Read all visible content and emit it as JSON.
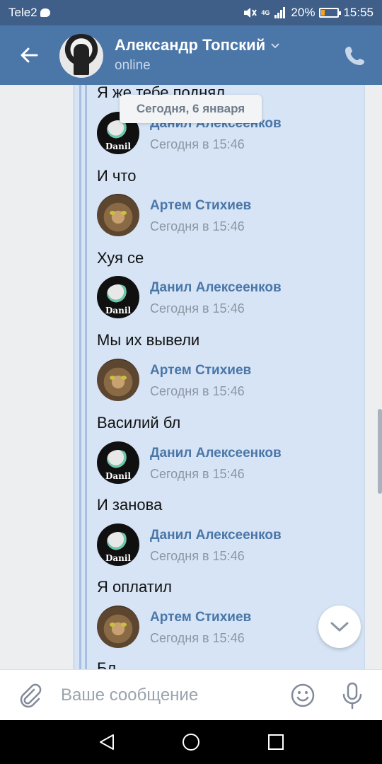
{
  "status_bar": {
    "carrier": "Tele2",
    "battery_percent": "20%",
    "battery_level": 0.2,
    "time": "15:55",
    "network": "4G"
  },
  "header": {
    "contact_name": "Александр Топский",
    "status": "online"
  },
  "chat": {
    "date_pill": "Сегодня, 6 января",
    "partial_top_text": "Я же тебе поднял",
    "partial_bottom_text": "Бл",
    "messages": [
      {
        "sender": "Данил Алексеенков",
        "time": "Сегодня в 15:46",
        "text": "И что",
        "avatar": "danil"
      },
      {
        "sender": "Артем Стихиев",
        "time": "Сегодня в 15:46",
        "text": "Хуя се",
        "avatar": "cat"
      },
      {
        "sender": "Данил Алексеенков",
        "time": "Сегодня в 15:46",
        "text": "Мы их вывели",
        "avatar": "danil"
      },
      {
        "sender": "Артем Стихиев",
        "time": "Сегодня в 15:46",
        "text": "Василий бл",
        "avatar": "cat"
      },
      {
        "sender": "Данил Алексеенков",
        "time": "Сегодня в 15:46",
        "text": "И занова",
        "avatar": "danil"
      },
      {
        "sender": "Данил Алексеенков",
        "time": "Сегодня в 15:46",
        "text": "Я оплатил",
        "avatar": "danil"
      },
      {
        "sender": "Артем Стихиев",
        "time": "Сегодня в 15:46",
        "text": "",
        "avatar": "cat"
      }
    ],
    "danil_avatar_text": "Danil"
  },
  "composer": {
    "placeholder": "Ваше сообщение",
    "value": ""
  },
  "colors": {
    "header_bg": "#4a76a8",
    "status_bg": "#3f5f88",
    "link_blue": "#4a76a8",
    "forward_bg": "#d6e4f5"
  },
  "icons": [
    "back-arrow-icon",
    "chevron-down-icon",
    "phone-icon",
    "chevron-down-icon",
    "paperclip-icon",
    "smile-icon",
    "microphone-icon",
    "nav-back-icon",
    "nav-home-icon",
    "nav-recent-icon"
  ]
}
